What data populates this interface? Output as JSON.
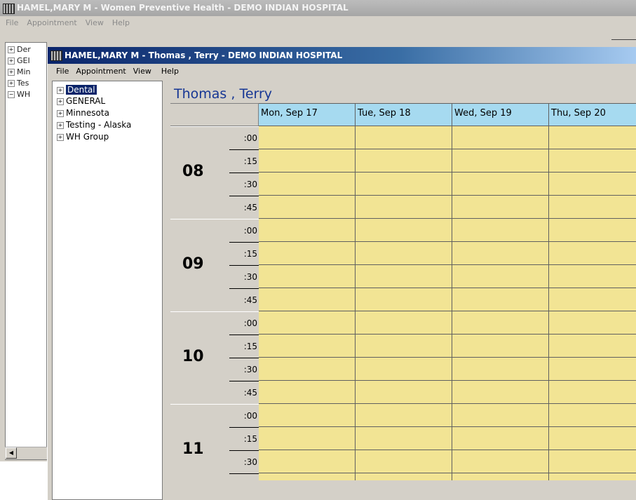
{
  "background_window": {
    "title": "HAMEL,MARY M - Women Preventive Health - DEMO INDIAN HOSPITAL",
    "menu": [
      "File",
      "Appointment",
      "View",
      "Help"
    ],
    "tree": [
      {
        "label": "Der",
        "expander": "+"
      },
      {
        "label": "GEI",
        "expander": "+"
      },
      {
        "label": "Min",
        "expander": "+"
      },
      {
        "label": "Tes",
        "expander": "+"
      },
      {
        "label": "WH",
        "expander": "−"
      }
    ]
  },
  "window": {
    "title": "HAMEL,MARY M - Thomas , Terry - DEMO INDIAN HOSPITAL",
    "menu": [
      "File",
      "Appointment",
      "View",
      "Help"
    ]
  },
  "tree": [
    {
      "label": "Dental",
      "expander": "+",
      "selected": true
    },
    {
      "label": "GENERAL",
      "expander": "+",
      "selected": false
    },
    {
      "label": "Minnesota",
      "expander": "+",
      "selected": false
    },
    {
      "label": "Testing - Alaska",
      "expander": "+",
      "selected": false
    },
    {
      "label": "WH Group",
      "expander": "+",
      "selected": false
    }
  ],
  "schedule": {
    "provider": "Thomas , Terry",
    "days": [
      "Mon, Sep 17",
      "Tue, Sep 18",
      "Wed, Sep 19",
      "Thu, Sep 20"
    ],
    "hours": [
      "08",
      "09",
      "10",
      "11"
    ],
    "minutes": [
      ":00",
      ":15",
      ":30",
      ":45"
    ]
  },
  "colors": {
    "slot": "#f2e494",
    "day_header": "#a6daf0",
    "provider_text": "#163694",
    "active_title": "#0a246a",
    "selection": "#0a246a"
  }
}
